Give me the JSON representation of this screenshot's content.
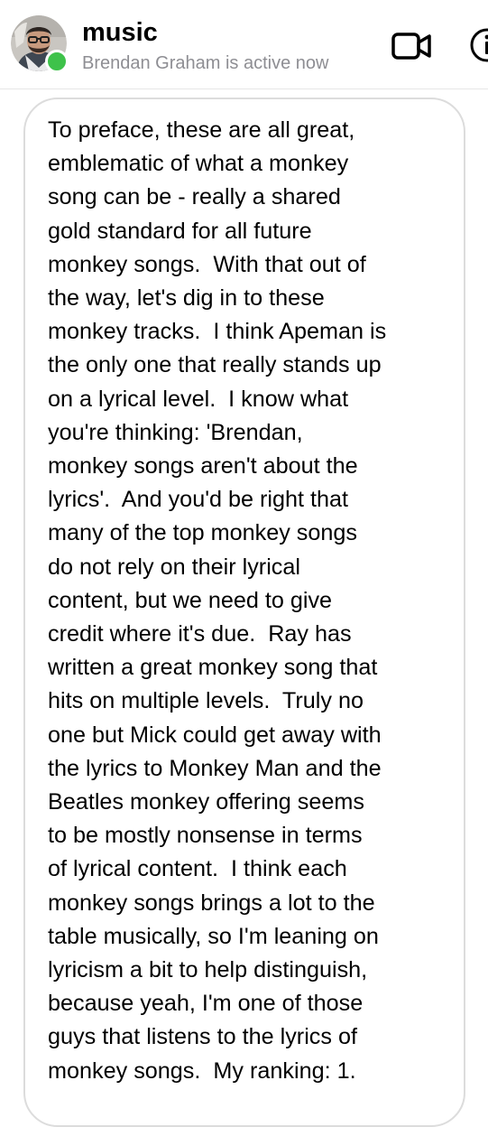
{
  "header": {
    "title": "music",
    "status": "Brendan Graham is active now",
    "icons": {
      "avatar": "profile-photo",
      "active_indicator": "green-dot",
      "video": "video-camera-icon",
      "info": "info-icon"
    },
    "colors": {
      "active": "#3ec24a",
      "status_text": "#8e8e93"
    }
  },
  "message": {
    "lines": [
      "To preface, these are all great,",
      "emblematic of what a monkey",
      "song can be - really a shared",
      "gold standard for all future",
      "monkey songs.  With that out of",
      "the way, let's dig in to these",
      "monkey tracks.  I think Apeman is",
      "the only one that really stands up",
      "on a lyrical level.  I know what",
      "you're thinking: 'Brendan,",
      "monkey songs aren't about the",
      "lyrics'.  And you'd be right that",
      "many of the top monkey songs",
      "do not rely on their lyrical",
      "content, but we need to give",
      "credit where it's due.  Ray has",
      "written a great monkey song that",
      "hits on multiple levels.  Truly no",
      "one but Mick could get away with",
      "the lyrics to Monkey Man and the",
      "Beatles monkey offering seems",
      "to be mostly nonsense in terms",
      "of lyrical content.  I think each",
      "monkey songs brings a lot to the",
      "table musically, so I'm leaning on",
      "lyricism a bit to help distinguish,",
      "because yeah, I'm one of those",
      "guys that listens to the lyrics of",
      "monkey songs.  My ranking: 1."
    ]
  }
}
